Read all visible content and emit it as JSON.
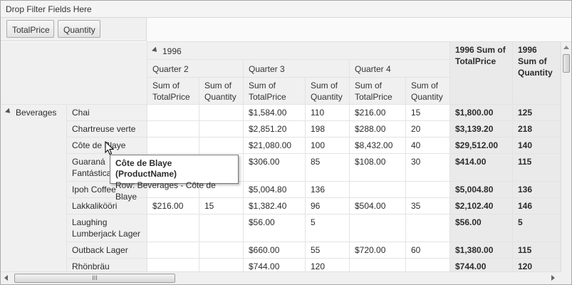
{
  "filter_bar": {
    "label": "Drop Filter Fields Here"
  },
  "data_fields": [
    "TotalPrice",
    "Quantity"
  ],
  "header": {
    "year": "1996",
    "quarters": [
      "Quarter 2",
      "Quarter 3",
      "Quarter 4"
    ],
    "measure_totalprice": "Sum of TotalPrice",
    "measure_quantity": "Sum of Quantity",
    "grand_totalprice": "1996 Sum of TotalPrice",
    "grand_quantity": "1996 Sum of Quantity"
  },
  "row_group": "Beverages",
  "rows": [
    {
      "product": "Chai",
      "q2_tp": "",
      "q2_qty": "",
      "q3_tp": "$1,584.00",
      "q3_qty": "110",
      "q4_tp": "$216.00",
      "q4_qty": "15",
      "total_tp": "$1,800.00",
      "total_qty": "125"
    },
    {
      "product": "Chartreuse verte",
      "q2_tp": "",
      "q2_qty": "",
      "q3_tp": "$2,851.20",
      "q3_qty": "198",
      "q4_tp": "$288.00",
      "q4_qty": "20",
      "total_tp": "$3,139.20",
      "total_qty": "218"
    },
    {
      "product": "Côte de Blaye",
      "q2_tp": "",
      "q2_qty": "",
      "q3_tp": "$21,080.00",
      "q3_qty": "100",
      "q4_tp": "$8,432.00",
      "q4_qty": "40",
      "total_tp": "$29,512.00",
      "total_qty": "140"
    },
    {
      "product": "Guaraná Fantástica",
      "q2_tp": "",
      "q2_qty": "",
      "q3_tp": "$306.00",
      "q3_qty": "85",
      "q4_tp": "$108.00",
      "q4_qty": "30",
      "total_tp": "$414.00",
      "total_qty": "115"
    },
    {
      "product": "Ipoh Coffee",
      "q2_tp": "",
      "q2_qty": "",
      "q3_tp": "$5,004.80",
      "q3_qty": "136",
      "q4_tp": "",
      "q4_qty": "",
      "total_tp": "$5,004.80",
      "total_qty": "136"
    },
    {
      "product": "Lakkalikööri",
      "q2_tp": "$216.00",
      "q2_qty": "15",
      "q3_tp": "$1,382.40",
      "q3_qty": "96",
      "q4_tp": "$504.00",
      "q4_qty": "35",
      "total_tp": "$2,102.40",
      "total_qty": "146"
    },
    {
      "product": "Laughing Lumberjack Lager",
      "q2_tp": "",
      "q2_qty": "",
      "q3_tp": "$56.00",
      "q3_qty": "5",
      "q4_tp": "",
      "q4_qty": "",
      "total_tp": "$56.00",
      "total_qty": "5"
    },
    {
      "product": "Outback Lager",
      "q2_tp": "",
      "q2_qty": "",
      "q3_tp": "$660.00",
      "q3_qty": "55",
      "q4_tp": "$720.00",
      "q4_qty": "60",
      "total_tp": "$1,380.00",
      "total_qty": "115"
    },
    {
      "product": "Rhönbräu",
      "q2_tp": "",
      "q2_qty": "",
      "q3_tp": "$744.00",
      "q3_qty": "120",
      "q4_tp": "",
      "q4_qty": "",
      "total_tp": "$744.00",
      "total_qty": "120"
    }
  ],
  "tooltip": {
    "title": "Côte de Blaye (ProductName)",
    "detail": "Row: Beverages - Côte de Blaye"
  },
  "scrollbar_thumb_label": "III",
  "icons": {
    "expand": "collapse-triangle-icon",
    "cursor": "mouse-pointer-icon"
  }
}
